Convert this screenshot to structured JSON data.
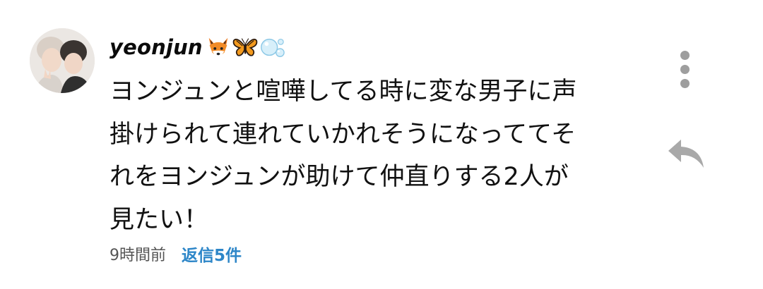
{
  "comment": {
    "author": "yeonjun",
    "author_emojis": [
      "fox-emoji",
      "butterfly-emoji",
      "bubbles-emoji"
    ],
    "text_lines": [
      "ヨンジュンと喧嘩してる時に変な男子に声",
      "掛けられて連れていかれそうになっててそ",
      "れをヨンジュンが助けて仲直りする2人が",
      "見たい！"
    ],
    "timestamp": "9時間前",
    "replies_label": "返信5件"
  },
  "actions": {
    "more_icon": "more-vertical-icon",
    "reply_icon": "reply-arrow-icon"
  },
  "colors": {
    "reply_link": "#2d86c8",
    "icon_gray": "#9e9e9e",
    "text": "#111111"
  }
}
